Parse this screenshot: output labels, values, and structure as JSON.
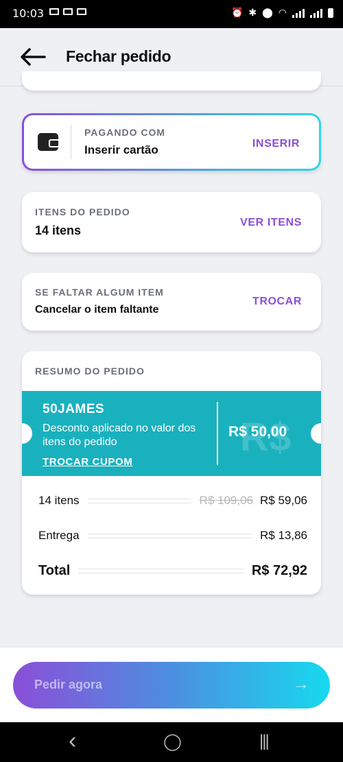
{
  "status_bar": {
    "time": "10:03"
  },
  "header": {
    "title": "Fechar pedido"
  },
  "payment": {
    "label": "PAGANDO COM",
    "value": "Inserir cartão",
    "action": "INSERIR"
  },
  "order_items": {
    "label": "ITENS DO PEDIDO",
    "value": "14 itens",
    "action": "VER ITENS"
  },
  "substitution": {
    "label": "SE FALTAR ALGUM ITEM",
    "value": "Cancelar o item faltante",
    "action": "TROCAR"
  },
  "summary": {
    "label": "RESUMO DO PEDIDO",
    "coupon": {
      "code": "50JAMES",
      "description": "Desconto aplicado no valor dos itens do pedido",
      "change_label": "TROCAR CUPOM",
      "watermark": "R$",
      "amount": "R$ 50,00"
    },
    "rows": [
      {
        "name": "14 itens",
        "old_price": "R$ 109,06",
        "price": "R$ 59,06"
      },
      {
        "name": "Entrega",
        "price": "R$ 13,86"
      }
    ],
    "total": {
      "name": "Total",
      "price": "R$ 72,92"
    }
  },
  "cta": {
    "label": "Pedir agora",
    "arrow": "→"
  },
  "nav": {
    "back": "‹",
    "home": "◯",
    "recents": "|||"
  },
  "colors": {
    "purple": "#8a4fd8",
    "teal": "#1ab1be",
    "cyan": "#17d9ee"
  }
}
